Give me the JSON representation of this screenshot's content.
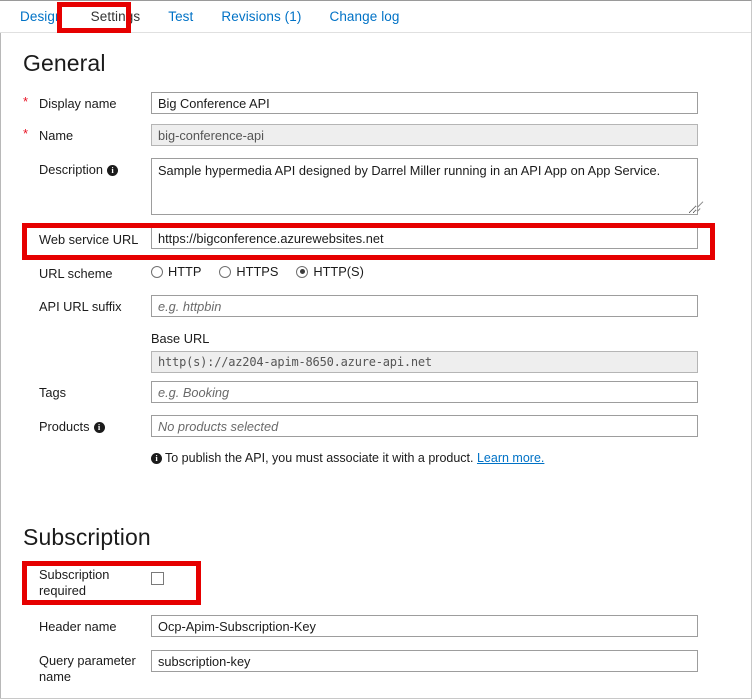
{
  "tabs": [
    {
      "label": "Design",
      "active": false
    },
    {
      "label": "Settings",
      "active": true
    },
    {
      "label": "Test",
      "active": false
    },
    {
      "label": "Revisions (1)",
      "active": false
    },
    {
      "label": "Change log",
      "active": false
    }
  ],
  "general": {
    "heading": "General",
    "display_name": {
      "label": "Display name",
      "value": "Big Conference API",
      "required": true
    },
    "name": {
      "label": "Name",
      "value": "big-conference-api",
      "required": true,
      "disabled": true
    },
    "description": {
      "label": "Description",
      "value": "Sample hypermedia API designed by Darrel Miller running in an API App on App Service.",
      "info": true
    },
    "web_service_url": {
      "label": "Web service URL",
      "value": "https://bigconference.azurewebsites.net",
      "highlighted": true
    },
    "url_scheme": {
      "label": "URL scheme",
      "options": [
        "HTTP",
        "HTTPS",
        "HTTP(S)"
      ],
      "selected": "HTTP(S)"
    },
    "api_url_suffix": {
      "label": "API URL suffix",
      "value": "",
      "placeholder": "e.g. httpbin"
    },
    "base_url": {
      "label": "Base URL",
      "value": "http(s)://az204-apim-8650.azure-api.net",
      "disabled": true
    },
    "tags": {
      "label": "Tags",
      "value": "",
      "placeholder": "e.g. Booking"
    },
    "products": {
      "label": "Products",
      "value": "",
      "placeholder": "No products selected",
      "info": true
    },
    "products_note": {
      "text": "To publish the API, you must associate it with a product.",
      "link_text": "Learn more."
    }
  },
  "subscription": {
    "heading": "Subscription",
    "required_toggle": {
      "label_line1": "Subscription",
      "label_line2": "required",
      "checked": false,
      "highlighted": true
    },
    "header_name": {
      "label": "Header name",
      "value": "Ocp-Apim-Subscription-Key"
    },
    "query_parameter_name": {
      "label_line1": "Query parameter",
      "label_line2": "name",
      "value": "subscription-key"
    }
  },
  "colors": {
    "link": "#0072c6",
    "highlight": "#e60000",
    "required_star": "#e81123",
    "text": "#1b1b1b",
    "disabled_bg": "#eeeeee"
  }
}
